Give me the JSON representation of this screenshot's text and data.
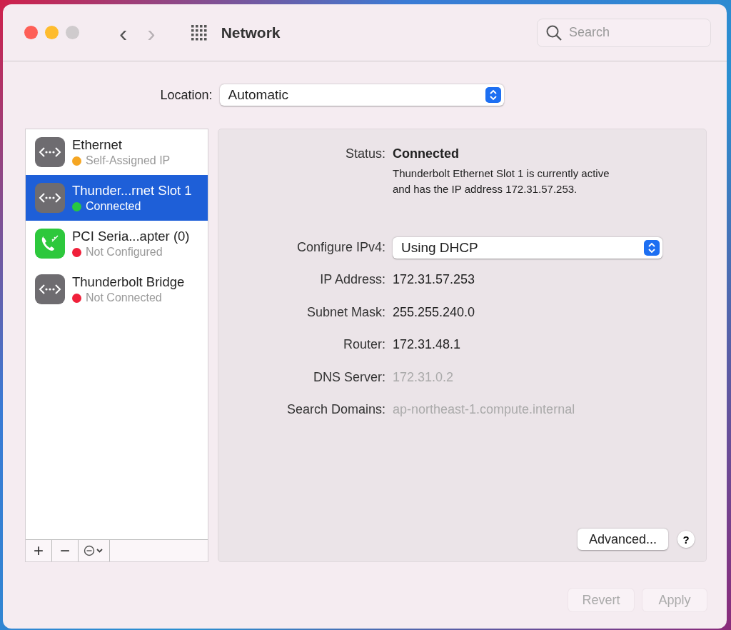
{
  "window": {
    "title": "Network"
  },
  "toolbar": {
    "back": {
      "label": "‹",
      "disabled": false
    },
    "forward": {
      "label": "›",
      "disabled": true
    },
    "search": {
      "placeholder": "Search"
    }
  },
  "location": {
    "label": "Location:",
    "value": "Automatic"
  },
  "services": [
    {
      "name": "Ethernet",
      "status": "Self-Assigned IP",
      "color": "#f5a623",
      "kind": "ethernet",
      "selected": false
    },
    {
      "name": "Thunder...rnet Slot 1",
      "status": "Connected",
      "color": "#28c840",
      "kind": "ethernet",
      "selected": true
    },
    {
      "name": "PCI Seria...apter (0)",
      "status": "Not Configured",
      "color": "#f0203a",
      "kind": "modem",
      "selected": false
    },
    {
      "name": "Thunderbolt Bridge",
      "status": "Not Connected",
      "color": "#f0203a",
      "kind": "ethernet",
      "selected": false
    }
  ],
  "sidebar_buttons": [
    {
      "label": "+"
    },
    {
      "label": "−"
    }
  ],
  "details": {
    "status_label": "Status:",
    "status": "Connected",
    "status_note": "Thunderbolt Ethernet Slot 1 is currently active\nand has the IP address 172.31.57.253.",
    "configure": {
      "label": "Configure IPv4:",
      "value": "Using DHCP"
    },
    "fields": [
      {
        "label": "IP Address:",
        "value": "172.31.57.253",
        "disabled": false
      },
      {
        "label": "Subnet Mask:",
        "value": "255.255.240.0",
        "disabled": false
      },
      {
        "label": "Router:",
        "value": "172.31.48.1",
        "disabled": false
      },
      {
        "label": "DNS Server:",
        "value": "172.31.0.2",
        "disabled": true
      },
      {
        "label": "Search Domains:",
        "value": "ap-northeast-1.compute.internal",
        "disabled": true
      }
    ],
    "advanced": {
      "label": "Advanced..."
    },
    "help": {
      "label": "?"
    }
  },
  "footer_buttons": [
    {
      "label": "Revert",
      "disabled": true
    },
    {
      "label": "Apply",
      "disabled": true
    }
  ]
}
